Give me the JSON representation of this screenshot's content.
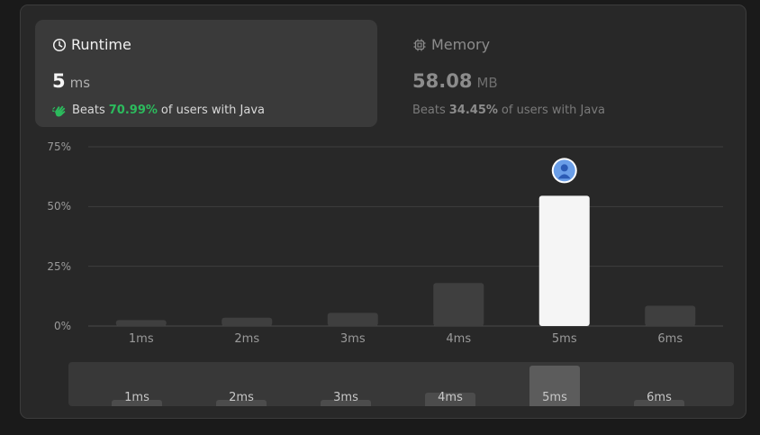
{
  "runtime_card": {
    "title": "Runtime",
    "value": "5",
    "unit": "ms",
    "beats_label": "Beats",
    "beats_percent": "70.99%",
    "beats_suffix": "of users with Java",
    "accent": "#2cbb5d"
  },
  "memory_card": {
    "title": "Memory",
    "value": "58.08",
    "unit": "MB",
    "beats_label": "Beats",
    "beats_percent": "34.45%",
    "beats_suffix": "of users with Java"
  },
  "chart_data": {
    "type": "bar",
    "categories": [
      "1ms",
      "2ms",
      "3ms",
      "4ms",
      "5ms",
      "6ms"
    ],
    "values": [
      2.5,
      3.5,
      5.5,
      18,
      54.5,
      8.5
    ],
    "y_ticks": [
      "0%",
      "25%",
      "50%",
      "75%"
    ],
    "ylim": [
      0,
      75
    ],
    "grid": true,
    "highlighted_category": "5ms",
    "bar_color": "#3f3f3f",
    "highlight_color": "#f5f5f5",
    "marker_icon": "user-avatar-icon"
  },
  "range_selector": {
    "labels": [
      "1ms",
      "2ms",
      "3ms",
      "4ms",
      "5ms",
      "6ms"
    ]
  }
}
